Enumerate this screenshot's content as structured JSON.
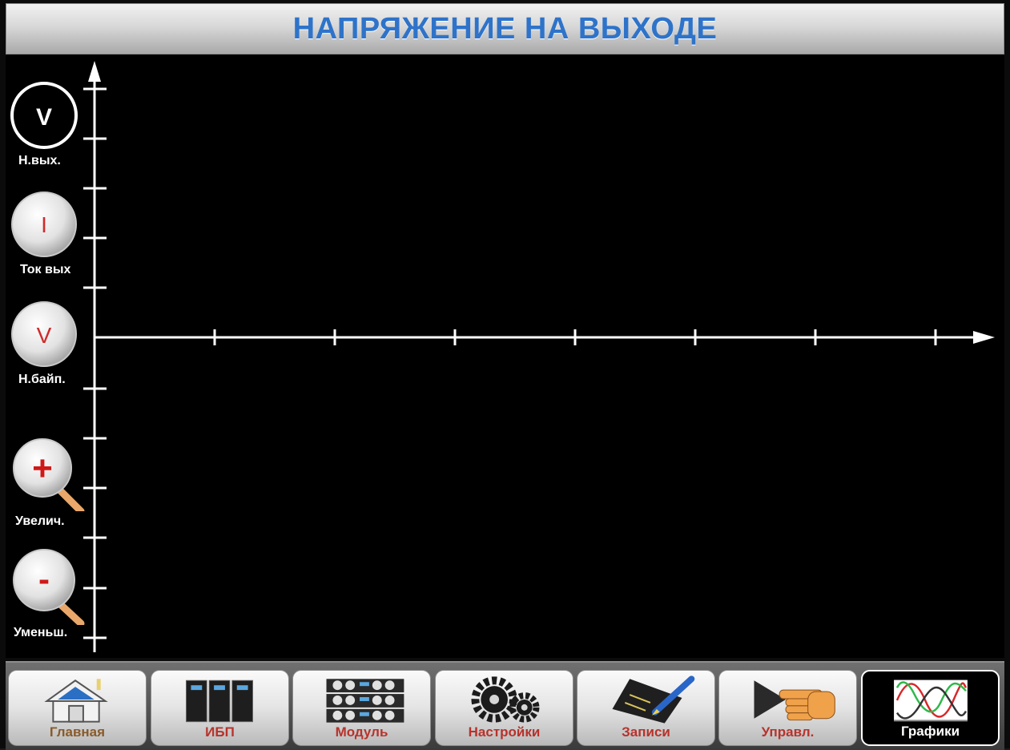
{
  "header": {
    "title": "НАПРЯЖЕНИЕ НА ВЫХОДЕ"
  },
  "side_buttons": [
    {
      "key": "v_out",
      "symbol": "V",
      "label": "Н.вых."
    },
    {
      "key": "i_out",
      "symbol": "I",
      "label": "Ток вых"
    },
    {
      "key": "v_bypass",
      "symbol": "V",
      "label": "Н.байп."
    },
    {
      "key": "zoom_in",
      "symbol": "+",
      "label": "Увелич."
    },
    {
      "key": "zoom_out",
      "symbol": "-",
      "label": "Уменьш."
    }
  ],
  "nav": {
    "items": [
      {
        "key": "home",
        "label": "Главная",
        "icon": "house-icon"
      },
      {
        "key": "ups",
        "label": "ИБП",
        "icon": "ups-cabinet-icon"
      },
      {
        "key": "module",
        "label": "Модуль",
        "icon": "module-rack-icon"
      },
      {
        "key": "settings",
        "label": "Настройки",
        "icon": "gears-icon"
      },
      {
        "key": "records",
        "label": "Записи",
        "icon": "notepad-pen-icon"
      },
      {
        "key": "control",
        "label": "Управл.",
        "icon": "pointing-hand-icon"
      },
      {
        "key": "graphs",
        "label": "Графики",
        "icon": "sine-waves-icon"
      }
    ],
    "active": "graphs"
  },
  "colors": {
    "title": "#2e73c9",
    "label_red": "#b8322b",
    "axis": "#ffffff",
    "wave_red": "#d8262a",
    "wave_green": "#2fb84a",
    "wave_black": "#333333"
  }
}
